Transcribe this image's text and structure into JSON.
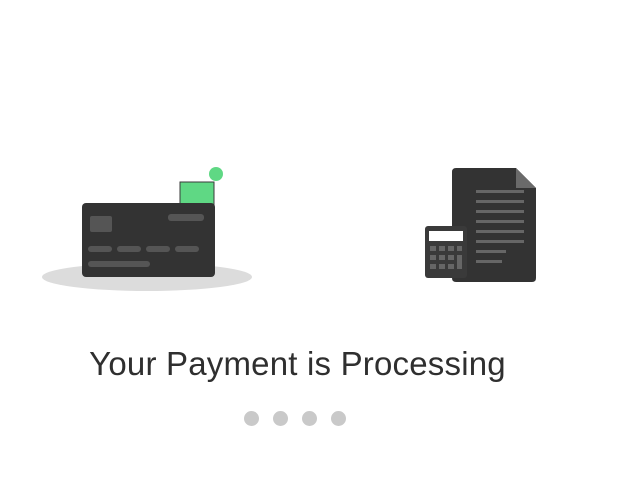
{
  "status": {
    "title": "Your Payment is Processing",
    "loading_dot_count": 4
  },
  "illustrations": {
    "left": "credit-card-icon",
    "right": "invoice-calculator-icon"
  },
  "colors": {
    "background": "#ffffff",
    "title_text": "#2f2f2f",
    "card_body": "#333333",
    "accent_green": "#5fd884",
    "dot_inactive": "#c9c9c9",
    "shadow": "#dcdcdc"
  }
}
